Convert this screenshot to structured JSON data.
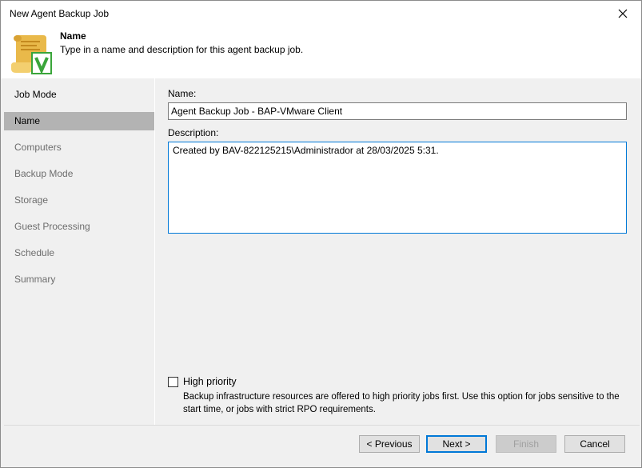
{
  "window": {
    "title": "New Agent Backup Job"
  },
  "header": {
    "title": "Name",
    "subtitle": "Type in a name and description for this agent backup job.",
    "icon": "scroll-with-checkmark-icon"
  },
  "sidebar": {
    "items": [
      {
        "label": "Job Mode",
        "state": "done"
      },
      {
        "label": "Name",
        "state": "active"
      },
      {
        "label": "Computers",
        "state": "pending"
      },
      {
        "label": "Backup Mode",
        "state": "pending"
      },
      {
        "label": "Storage",
        "state": "pending"
      },
      {
        "label": "Guest Processing",
        "state": "pending"
      },
      {
        "label": "Schedule",
        "state": "pending"
      },
      {
        "label": "Summary",
        "state": "pending"
      }
    ]
  },
  "form": {
    "name_label": "Name:",
    "name_value": "Agent Backup Job - BAP-VMware Client",
    "description_label": "Description:",
    "description_value": "Created by BAV-822125215\\Administrador at 28/03/2025 5:31.",
    "high_priority_label": "High priority",
    "high_priority_checked": false,
    "high_priority_help": "Backup infrastructure resources are offered to high priority jobs first. Use this option for jobs sensitive to the start time, or jobs with strict RPO requirements."
  },
  "buttons": {
    "previous": "< Previous",
    "next": "Next >",
    "finish": "Finish",
    "cancel": "Cancel"
  },
  "colors": {
    "accent": "#0078d7",
    "sidebar_active": "#b3b3b3",
    "icon_green": "#3aa53a",
    "icon_scroll": "#e9b94a"
  }
}
